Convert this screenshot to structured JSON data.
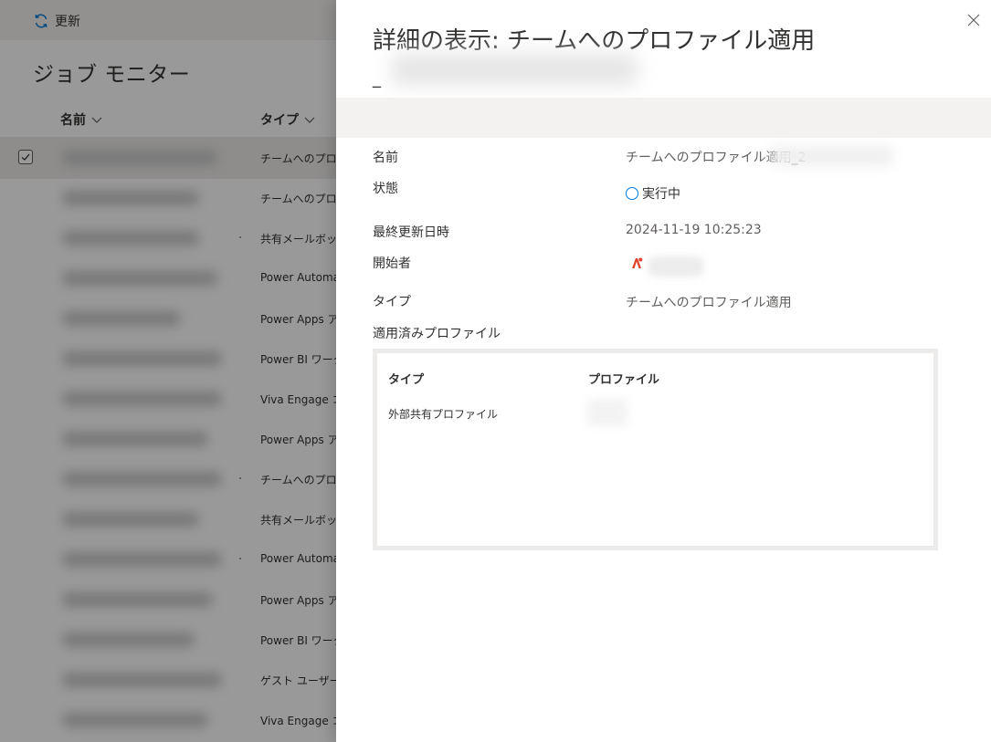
{
  "commandbar": {
    "refresh_label": "更新"
  },
  "page": {
    "title": "ジョブ モニター"
  },
  "list": {
    "headers": {
      "name": "名前",
      "type": "タイプ"
    },
    "type_cells": [
      "チームへのプロファ",
      "チームへのプロファ",
      "共有メールボックス",
      "Power Automa",
      "Power Apps ア",
      "Power BI ワーク",
      "Viva Engage コ",
      "Power Apps ア",
      "チームへのプロファ",
      "共有メールボックス",
      "Power Automa",
      "Power Apps ア",
      "Power BI ワーク",
      "ゲスト ユーザーの",
      "Viva Engage コ"
    ]
  },
  "panel": {
    "title": "詳細の表示: チームへのプロファイル適用",
    "subtitle_prefix": "_",
    "fields": {
      "name_label": "名前",
      "name_value": "チームへのプロファイル適用_2",
      "status_label": "状態",
      "status_value": "実行中",
      "updated_label": "最終更新日時",
      "updated_value": "2024-11-19 10:25:23",
      "initiator_label": "開始者",
      "type_label": "タイプ",
      "type_value": "チームへのプロファイル適用",
      "applied_label": "適用済みプロファイル"
    },
    "profiles_table": {
      "headers": {
        "type": "タイプ",
        "profile": "プロファイル"
      },
      "rows": [
        {
          "type": "外部共有プロファイル"
        }
      ]
    }
  },
  "colors": {
    "accent": "#0078d4",
    "initiator_icon": "#e3412a"
  },
  "icons": {
    "refresh": "refresh-icon",
    "close": "close-icon",
    "status": "status-running-icon",
    "initiator": "user-avatar-icon"
  }
}
